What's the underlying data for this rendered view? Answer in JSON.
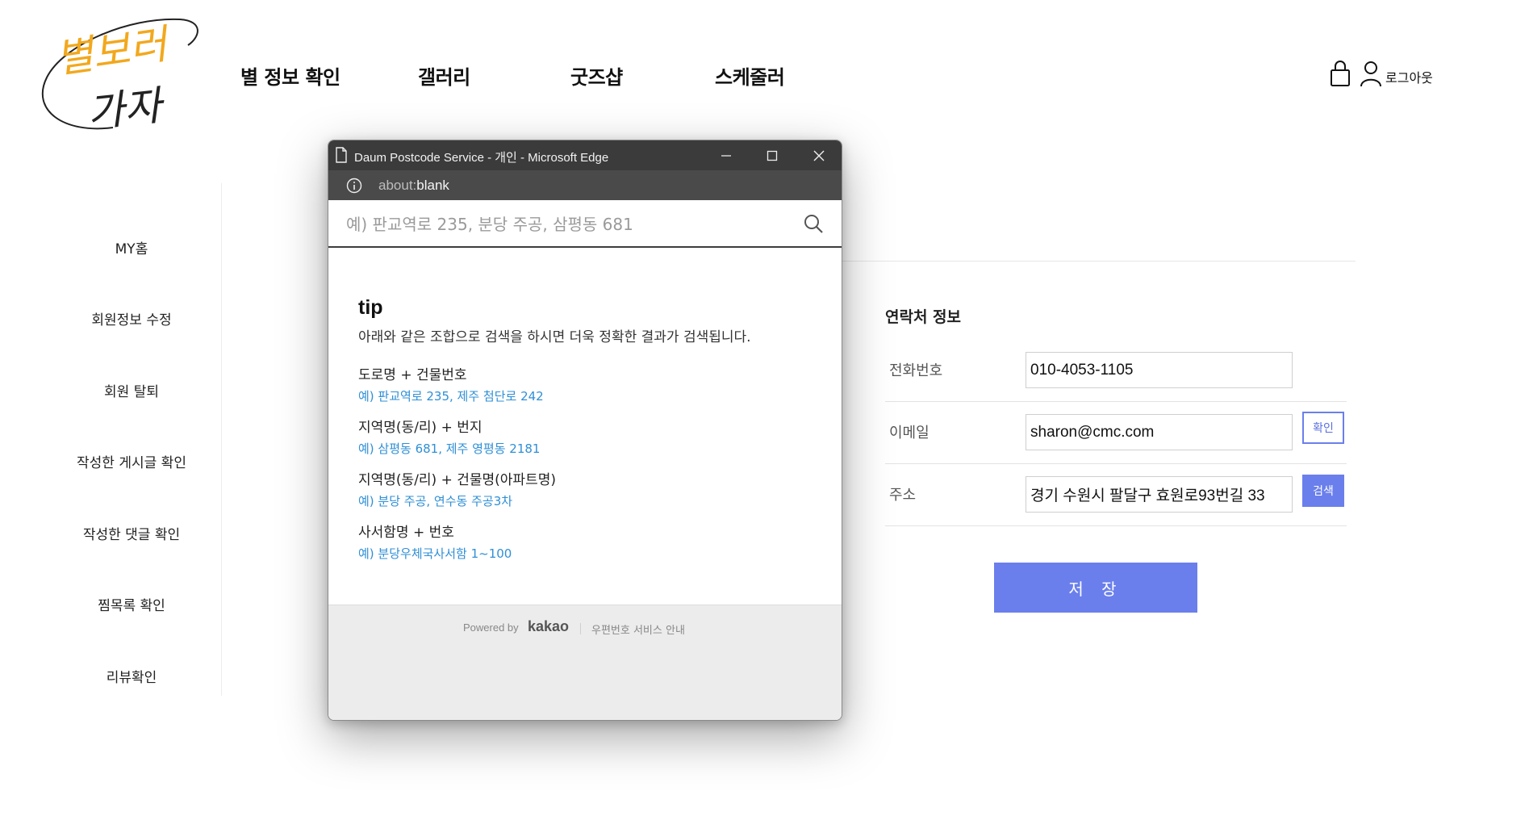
{
  "header": {
    "logo_text_line1": "별보러",
    "logo_text_line2": "가자",
    "nav": [
      "별 정보 확인",
      "갤러리",
      "굿즈샵",
      "스케줄러"
    ],
    "logout_label": "로그아웃",
    "cart_icon": "shopping-bag-icon",
    "user_icon": "user-icon"
  },
  "sidebar": {
    "items": [
      "MY홈",
      "회원정보 수정",
      "회원 탈퇴",
      "작성한 게시글 확인",
      "작성한 댓글 확인",
      "찜목록 확인",
      "리뷰확인"
    ]
  },
  "form": {
    "section_title": "연락처 정보",
    "phone_label": "전화번호",
    "phone_value": "010-4053-1105",
    "email_label": "이메일",
    "email_value": "sharon@cmc.com",
    "confirm_button": "확인",
    "address_label": "주소",
    "address_value": "경기 수원시 팔달구 효원로93번길 33",
    "search_button": "검색",
    "save_button": "저 장",
    "accent_color": "#6a7fec"
  },
  "popup": {
    "window_title": "Daum Postcode Service - 개인 - Microsoft Edge",
    "address_prefix": "about:",
    "address_main": "blank",
    "search_placeholder": "예) 판교역로 235, 분당 주공, 삼평동 681",
    "tip_title": "tip",
    "tip_description": "아래와 같은 조합으로 검색을 하시면 더욱 정확한 결과가 검색됩니다.",
    "examples": [
      {
        "label": "도로명 + 건물번호",
        "sample": "예) 판교역로 235,  제주 첨단로 242"
      },
      {
        "label": "지역명(동/리) + 번지",
        "sample": "예) 삼평동 681,  제주 영평동 2181"
      },
      {
        "label": "지역명(동/리) + 건물명(아파트명)",
        "sample": "예) 분당 주공,  연수동 주공3차"
      },
      {
        "label": "사서함명 + 번호",
        "sample": "예) 분당우체국사서함 1~100"
      }
    ],
    "powered_by": "Powered by",
    "brand": "kakao",
    "postcode_guide": "우편번호 서비스 안내",
    "sample_color": "#2f8fd6"
  }
}
